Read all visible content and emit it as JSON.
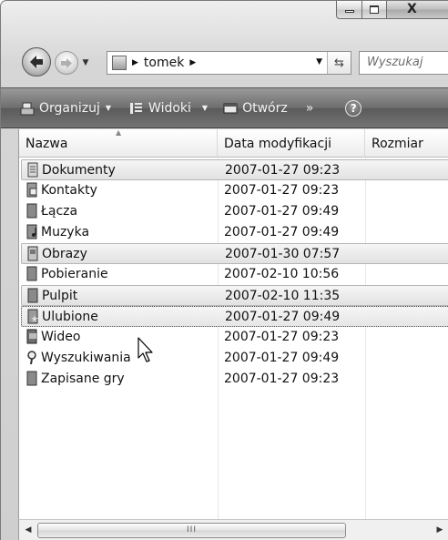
{
  "window": {
    "caption_buttons": {
      "minimize_icon": "minimize-icon",
      "maximize_icon": "maximize-icon",
      "close_label": "X"
    }
  },
  "address_bar": {
    "path": [
      "tomek"
    ],
    "search_placeholder": "Wyszukaj"
  },
  "toolbar": {
    "organize_label": "Organizuj",
    "views_label": "Widoki",
    "open_label": "Otwórz",
    "more_label": "»",
    "help_label": "?"
  },
  "list": {
    "columns": [
      "Nazwa",
      "Data modyfikacji",
      "Rozmiar"
    ],
    "rows": [
      {
        "name": "Dokumenty",
        "modified": "2007-01-27 09:23",
        "icon": "documents-folder-icon",
        "state": "selected"
      },
      {
        "name": "Kontakty",
        "modified": "2007-01-27 09:23",
        "icon": "contacts-folder-icon",
        "state": "normal"
      },
      {
        "name": "Łącza",
        "modified": "2007-01-27 09:49",
        "icon": "links-folder-icon",
        "state": "normal"
      },
      {
        "name": "Muzyka",
        "modified": "2007-01-27 09:49",
        "icon": "music-folder-icon",
        "state": "normal"
      },
      {
        "name": "Obrazy",
        "modified": "2007-01-30 07:57",
        "icon": "pictures-folder-icon",
        "state": "selected"
      },
      {
        "name": "Pobieranie",
        "modified": "2007-02-10 10:56",
        "icon": "downloads-folder-icon",
        "state": "normal"
      },
      {
        "name": "Pulpit",
        "modified": "2007-02-10 11:35",
        "icon": "desktop-folder-icon",
        "state": "selected"
      },
      {
        "name": "Ulubione",
        "modified": "2007-01-27 09:49",
        "icon": "favorites-folder-icon",
        "state": "focused"
      },
      {
        "name": "Wideo",
        "modified": "2007-01-27 09:23",
        "icon": "videos-folder-icon",
        "state": "normal"
      },
      {
        "name": "Wyszukiwania",
        "modified": "2007-01-27 09:49",
        "icon": "searches-folder-icon",
        "state": "normal"
      },
      {
        "name": "Zapisane gry",
        "modified": "2007-01-27 09:23",
        "icon": "saved-games-folder-icon",
        "state": "normal"
      }
    ]
  },
  "scrollbar": {
    "thumb_grip": "III"
  }
}
